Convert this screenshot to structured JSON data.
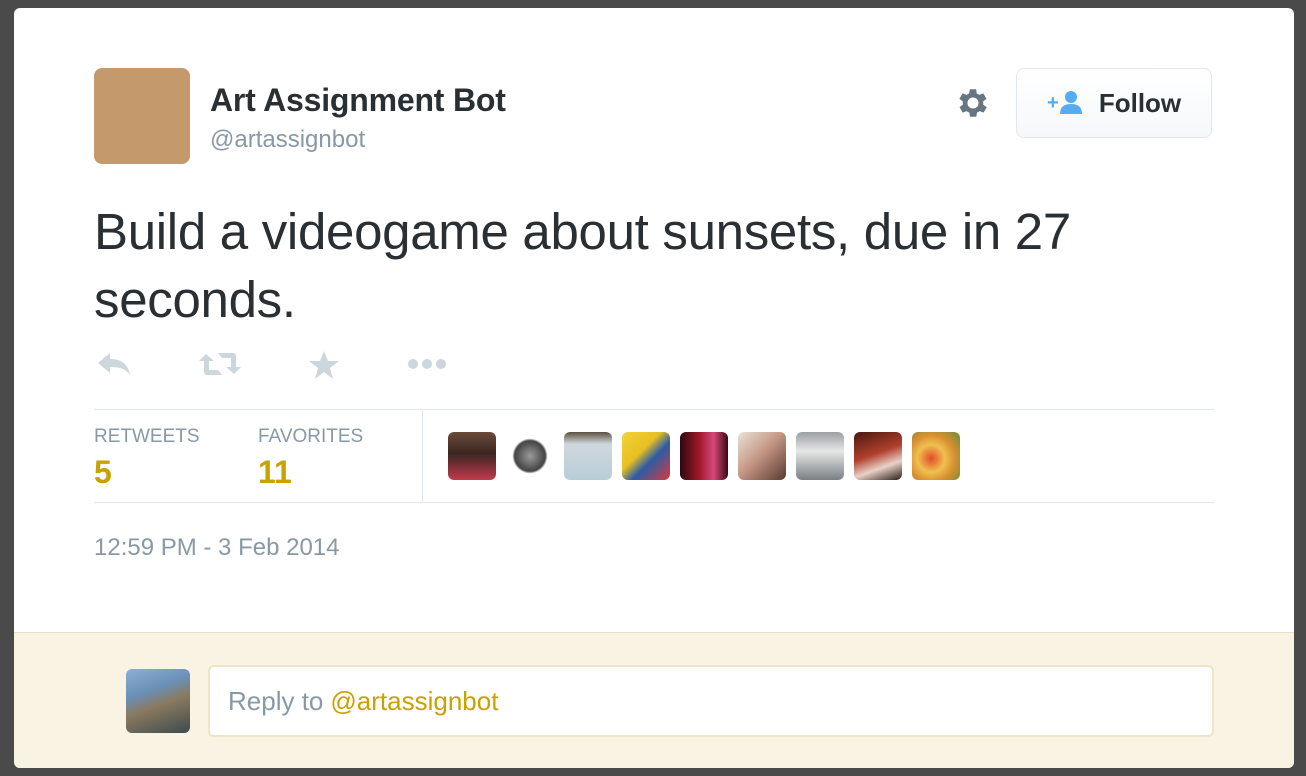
{
  "header": {
    "display_name": "Art Assignment Bot",
    "handle": "@artassignbot",
    "avatar_color": "#c49a6c",
    "follow_label": "Follow"
  },
  "tweet": {
    "text": "Build a videogame about sunsets, due in 27 seconds.",
    "timestamp": "12:59 PM - 3 Feb 2014"
  },
  "actions": [
    "reply-icon",
    "retweet-icon",
    "favorite-star-icon",
    "more-dots-icon"
  ],
  "stats": {
    "retweets_label": "RETWEETS",
    "retweets_value": "5",
    "favorites_label": "FAVORITES",
    "favorites_value": "11"
  },
  "favoriters_count_shown": 9,
  "reply": {
    "prefix": "Reply to",
    "mention": "@artassignbot"
  },
  "colors": {
    "accent": "#c9a100",
    "muted_text": "#8899a6",
    "primary_text": "#292f33",
    "reply_bg": "#f9f3e4"
  }
}
